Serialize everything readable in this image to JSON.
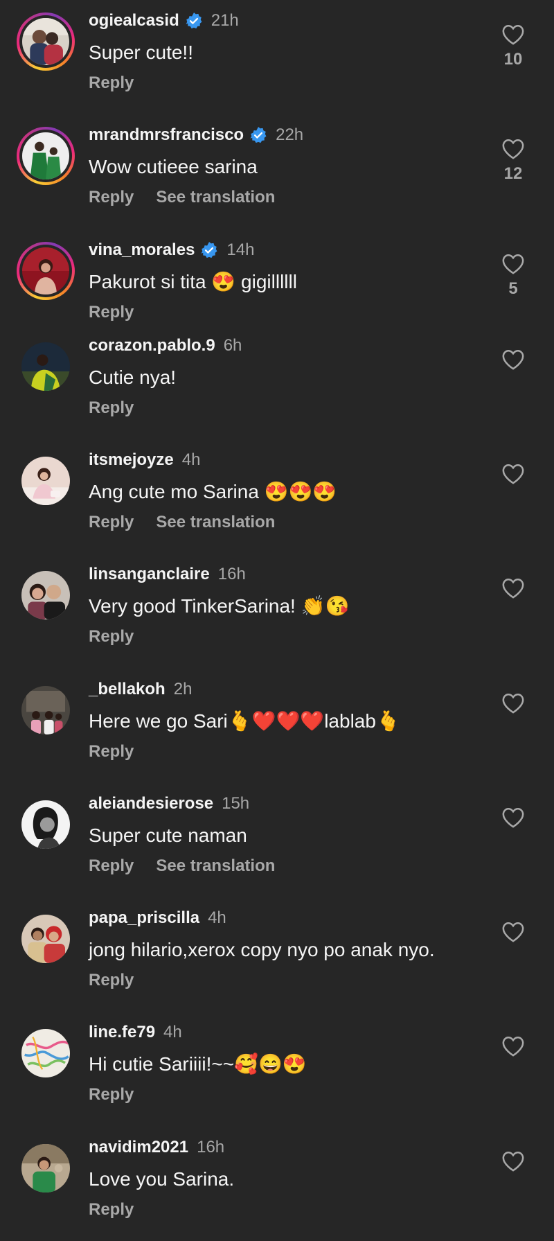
{
  "theme": {
    "background": "#262626",
    "text": "#f5f5f5",
    "muted": "#a8a8a8",
    "verified": "#3897f0"
  },
  "comments": [
    {
      "username": "ogiealcasid",
      "verified": true,
      "time": "21h",
      "text": "Super cute!!",
      "actions": [
        "Reply"
      ],
      "likes": "10",
      "avatar_icon": "couple-photo-icon"
    },
    {
      "username": "mrandmrsfrancisco",
      "verified": true,
      "time": "22h",
      "text": "Wow cutieee sarina",
      "actions": [
        "Reply",
        "See translation"
      ],
      "likes": "12",
      "avatar_icon": "family-photo-icon"
    },
    {
      "username": "vina_morales",
      "verified": true,
      "time": "14h",
      "text": "Pakurot si tita 😍 gigillllll",
      "actions": [
        "Reply"
      ],
      "likes": "5",
      "avatar_icon": "woman-red-photo-icon"
    },
    {
      "username": "corazon.pablo.9",
      "verified": false,
      "time": "6h",
      "text": "Cutie nya!",
      "actions": [
        "Reply"
      ],
      "likes": "",
      "avatar_icon": "person-green-photo-icon"
    },
    {
      "username": "itsmejoyze",
      "verified": false,
      "time": "4h",
      "text": "Ang cute mo Sarina 😍😍😍",
      "actions": [
        "Reply",
        "See translation"
      ],
      "likes": "",
      "avatar_icon": "woman-photo-icon"
    },
    {
      "username": "linsanganclaire",
      "verified": false,
      "time": "16h",
      "text": "Very good TinkerSarina! 👏😘",
      "actions": [
        "Reply"
      ],
      "likes": "",
      "avatar_icon": "couple-selfie-icon"
    },
    {
      "username": "_bellakoh",
      "verified": false,
      "time": "2h",
      "text": "Here we go Sari🫰❤️❤️❤️lablab🫰",
      "actions": [
        "Reply"
      ],
      "likes": "",
      "avatar_icon": "group-photo-icon"
    },
    {
      "username": "aleiandesierose",
      "verified": false,
      "time": "15h",
      "text": "Super cute naman",
      "actions": [
        "Reply",
        "See translation"
      ],
      "likes": "",
      "avatar_icon": "woman-bw-photo-icon"
    },
    {
      "username": "papa_priscilla",
      "verified": false,
      "time": "4h",
      "text": "jong hilario,xerox copy nyo po anak nyo.",
      "actions": [
        "Reply"
      ],
      "likes": "",
      "avatar_icon": "couple-red-photo-icon"
    },
    {
      "username": "line.fe79",
      "verified": false,
      "time": "4h",
      "text": "Hi cutie Sariiii!~~🥰😄😍",
      "actions": [
        "Reply"
      ],
      "likes": "",
      "avatar_icon": "abstract-art-icon"
    },
    {
      "username": "navidim2021",
      "verified": false,
      "time": "16h",
      "text": "Love you Sarina.",
      "actions": [
        "Reply"
      ],
      "likes": "",
      "avatar_icon": "child-photo-icon"
    }
  ]
}
